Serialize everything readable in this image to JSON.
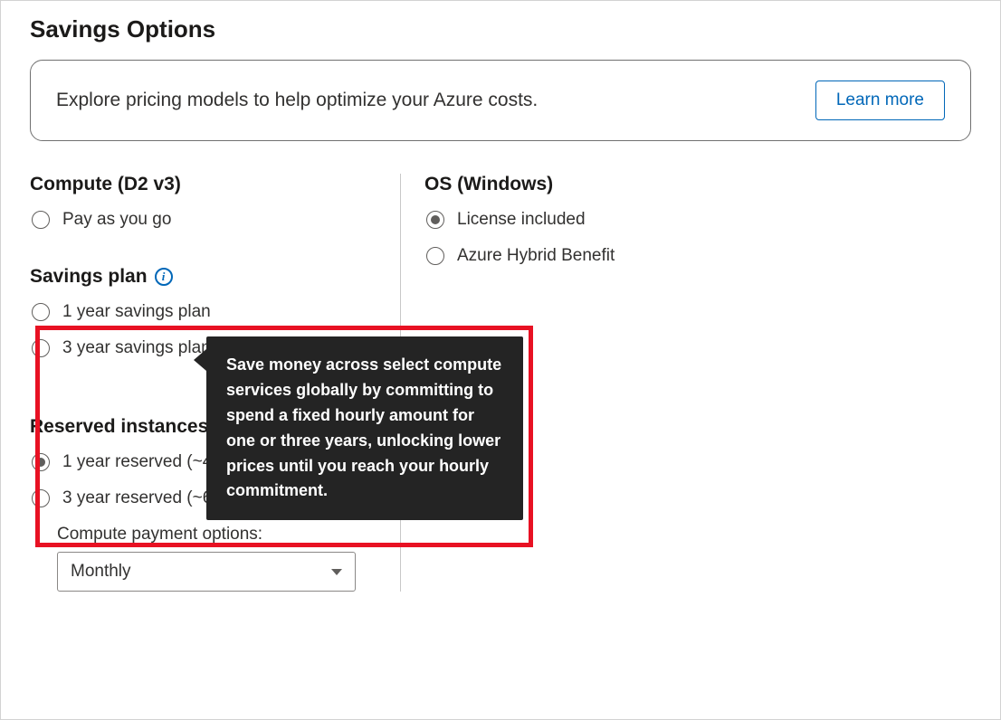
{
  "title": "Savings Options",
  "banner": {
    "text": "Explore pricing models to help optimize your Azure costs.",
    "cta": "Learn more"
  },
  "compute": {
    "heading": "Compute (D2 v3)",
    "payg": "Pay as you go"
  },
  "savings_plan": {
    "heading": "Savings plan",
    "tooltip": "Save money across select compute services globally by committing to spend a fixed hourly amount for one or three years, unlocking lower prices until you reach your hourly commitment.",
    "opt1": "1 year savings plan",
    "opt2": "3 year savings plan"
  },
  "reserved": {
    "heading": "Reserved instances",
    "opt1": "1 year reserved (~40% discount)",
    "opt2": "3 year reserved (~62% discount)",
    "payment_label": "Compute payment options:",
    "payment_value": "Monthly"
  },
  "os": {
    "heading": "OS (Windows)",
    "opt1": "License included",
    "opt2": "Azure Hybrid Benefit"
  }
}
